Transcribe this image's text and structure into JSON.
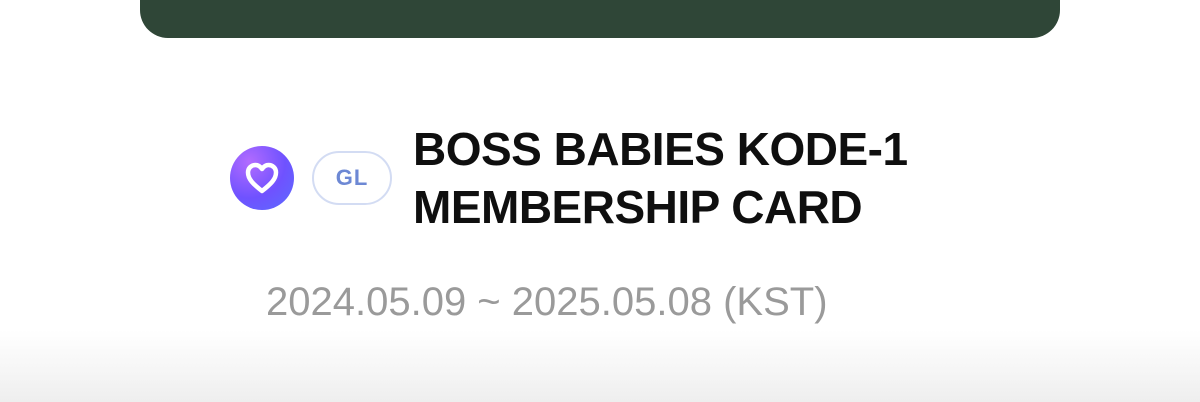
{
  "card": {
    "color": "#2f4637"
  },
  "app_icon": {
    "name": "heart-app-icon",
    "accent": "#7a5cff"
  },
  "badge": {
    "label": "GL"
  },
  "title": {
    "line1": "BOSS BABIES KODE-1",
    "line2": "MEMBERSHIP CARD"
  },
  "period": {
    "text": "2024.05.09 ~ 2025.05.08 (KST)"
  }
}
